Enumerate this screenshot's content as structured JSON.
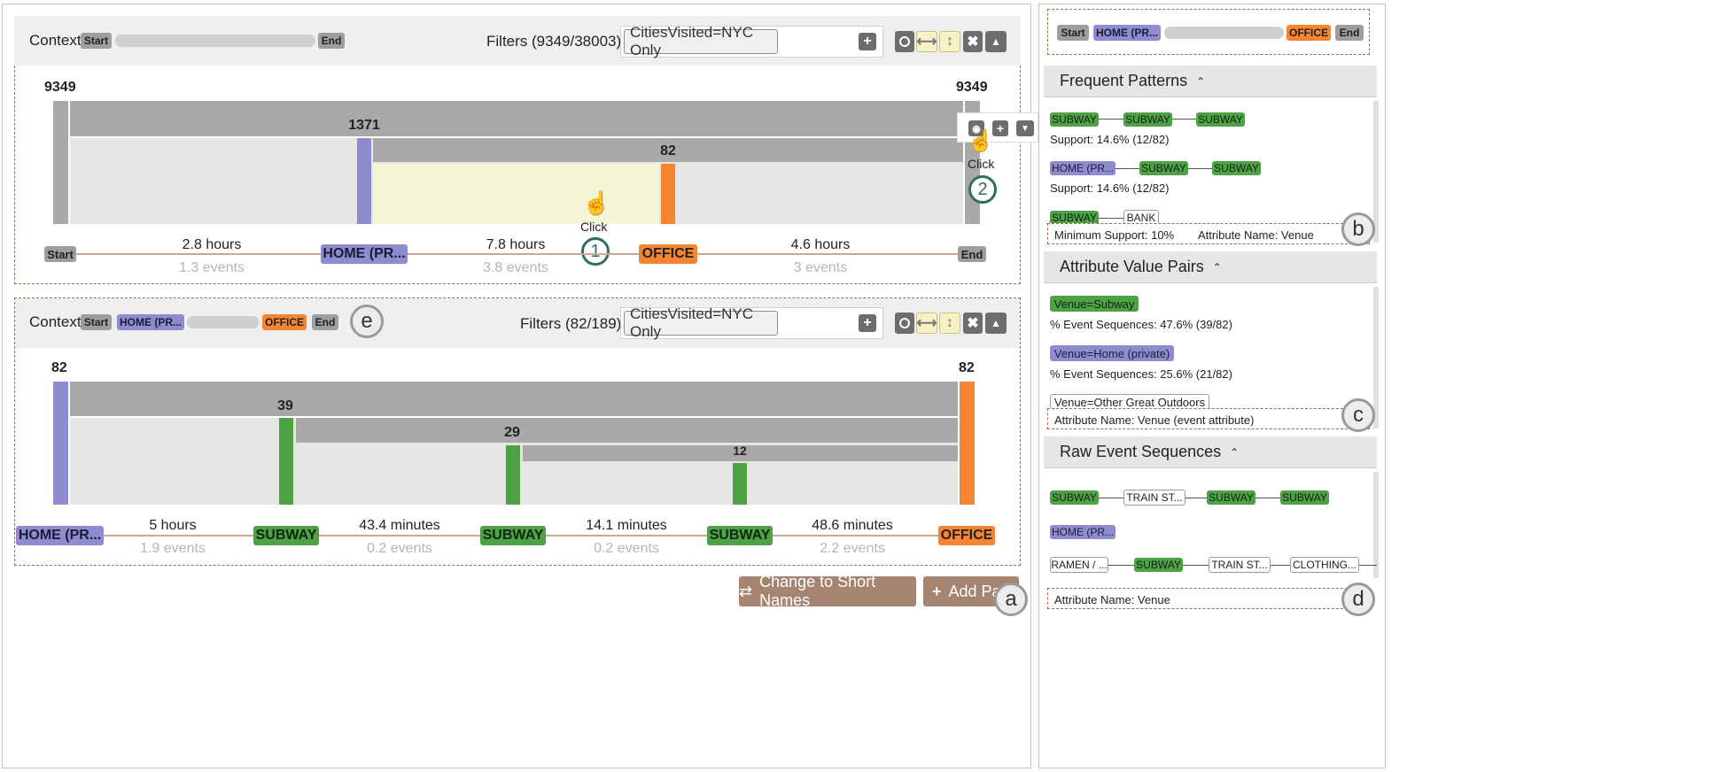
{
  "top_panel": {
    "context_label": "Context:",
    "context_tags": [
      "Start",
      "End"
    ],
    "filters_label": "Filters (9349/38003) :",
    "filter_chip": "CitiesVisited=NYC Only",
    "add_filter": "+",
    "flow_counts": {
      "left": "9349",
      "right": "9349",
      "home_branch": "1371",
      "office_branch": "82"
    },
    "timeline": {
      "nodes": [
        "Start",
        "HOME (PR...",
        "OFFICE",
        "End"
      ],
      "durations": [
        "2.8 hours",
        "7.8 hours",
        "4.6 hours"
      ],
      "events": [
        "1.3 events",
        "3.8 events",
        "3 events"
      ]
    },
    "click1": "Click",
    "click2": "Click",
    "step1": "1",
    "step2": "2"
  },
  "bottom_panel": {
    "context_label": "Context:",
    "context_tags": [
      "Start",
      "HOME (PR...",
      "OFFICE",
      "End"
    ],
    "label_e": "e",
    "filters_label": "Filters (82/189) :",
    "filter_chip": "CitiesVisited=NYC Only",
    "add_filter": "+",
    "flow_counts": {
      "left": "82",
      "right": "82",
      "b1": "39",
      "b2": "29",
      "b3": "12"
    },
    "timeline": {
      "nodes": [
        "HOME (PR...",
        "SUBWAY",
        "SUBWAY",
        "SUBWAY",
        "OFFICE"
      ],
      "durations": [
        "5 hours",
        "43.4 minutes",
        "14.1 minutes",
        "48.6 minutes"
      ],
      "events": [
        "1.9 events",
        "0.2 events",
        "0.2 events",
        "2.2 events"
      ]
    }
  },
  "footer": {
    "change_names": "Change to Short Names",
    "add_panel": "Add Pa",
    "label_a": "a"
  },
  "right_panel": {
    "context_tags": [
      "Start",
      "HOME (PR...",
      "OFFICE",
      "End"
    ],
    "frequent_patterns": {
      "title": "Frequent Patterns",
      "p1": [
        "SUBWAY",
        "SUBWAY",
        "SUBWAY"
      ],
      "p1_support": "Support: 14.6% (12/82)",
      "p2": [
        "HOME (PR...",
        "SUBWAY",
        "SUBWAY"
      ],
      "p2_support": "Support: 14.6% (12/82)",
      "p3": [
        "SUBWAY",
        "BANK"
      ],
      "footer_min": "Minimum Support: 10%",
      "footer_attr": "Attribute Name: Venue",
      "label": "b"
    },
    "attribute_value_pairs": {
      "title": "Attribute Value Pairs",
      "a1": "Venue=Subway",
      "a1_pct": "% Event Sequences: 47.6% (39/82)",
      "a2": "Venue=Home (private)",
      "a2_pct": "% Event Sequences: 25.6% (21/82)",
      "a3": "Venue=Other Great Outdoors",
      "footer": "Attribute Name: Venue (event attribute)",
      "label": "c"
    },
    "raw_event_sequences": {
      "title": "Raw Event Sequences",
      "r1": [
        "SUBWAY",
        "TRAIN ST...",
        "SUBWAY",
        "SUBWAY"
      ],
      "r2": [
        "HOME (PR..."
      ],
      "r3": [
        "RAMEN / ...",
        "SUBWAY",
        "TRAIN ST...",
        "CLOTHING..."
      ],
      "footer": "Attribute Name: Venue",
      "label": "d"
    }
  },
  "colors": {
    "gray": "#9e9e9e",
    "blue": "#8e8ccf",
    "orange": "#f58530",
    "green": "#4fa146",
    "highlight": "#f3f5d6",
    "brown": "#a58472"
  }
}
